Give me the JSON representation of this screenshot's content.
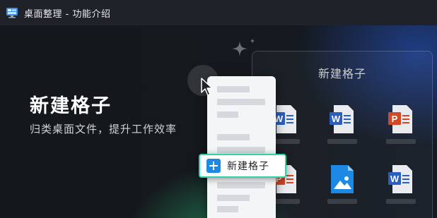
{
  "window": {
    "title": "桌面整理 - 功能介绍"
  },
  "hero": {
    "heading": "新建格子",
    "subheading": "归类桌面文件，提升工作效率"
  },
  "grid_panel": {
    "title": "新建格子",
    "files": [
      {
        "type": "word",
        "letter": "W"
      },
      {
        "type": "word",
        "letter": "W"
      },
      {
        "type": "powerpoint",
        "letter": "P"
      },
      {
        "type": "powerpoint",
        "letter": "P"
      },
      {
        "type": "image",
        "letter": ""
      },
      {
        "type": "word",
        "letter": "W"
      }
    ]
  },
  "context_menu": {
    "new_grid_label": "新建格子"
  },
  "icons": {
    "app": "desktop-monitor-icon",
    "sparkle": "sparkle-icon",
    "cursor": "mouse-pointer-icon",
    "plus": "plus-icon"
  },
  "colors": {
    "word_blue": "#2b5fbf",
    "ppt_orange": "#d24726",
    "image_blue": "#1e88e5",
    "highlight_green": "#2dd4a8"
  }
}
